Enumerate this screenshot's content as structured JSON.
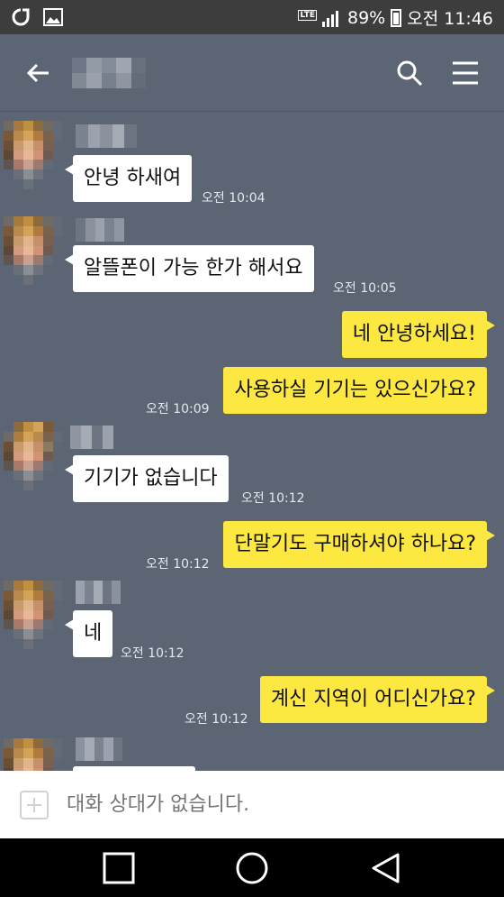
{
  "status_bar": {
    "network": "LTE",
    "battery": "89%",
    "time": "오전 11:46"
  },
  "header": {
    "back_icon": "arrow-left-icon",
    "search_icon": "search-icon",
    "menu_icon": "hamburger-menu-icon"
  },
  "messages": [
    {
      "side": "in",
      "text": "안녕 하새여",
      "time": "오전 10:04"
    },
    {
      "side": "in",
      "text": "알뜰폰이  가능 한가 해서요",
      "time": "오전 10:05"
    },
    {
      "side": "out",
      "text": "네 안녕하세요!",
      "time": ""
    },
    {
      "side": "out",
      "text": "사용하실 기기는 있으신가요?",
      "time": "오전 10:09"
    },
    {
      "side": "in",
      "text": "기기가 없습니다",
      "time": "오전 10:12"
    },
    {
      "side": "out",
      "text": "단말기도 구매하셔야 하나요?",
      "time": "오전 10:12"
    },
    {
      "side": "in",
      "text": "네",
      "time": "오전 10:12"
    },
    {
      "side": "out",
      "text": "계신 지역이 어디신가요?",
      "time": "오전 10:12"
    }
  ],
  "input": {
    "placeholder": "대화 상대가 없습니다.",
    "plus_icon": "plus-icon"
  },
  "nav": {
    "recents_icon": "square-recents-icon",
    "home_icon": "circle-home-icon",
    "back_icon": "triangle-back-icon"
  },
  "colors": {
    "background": "#5c6574",
    "outgoing_bubble": "#fde741",
    "incoming_bubble": "#ffffff"
  }
}
